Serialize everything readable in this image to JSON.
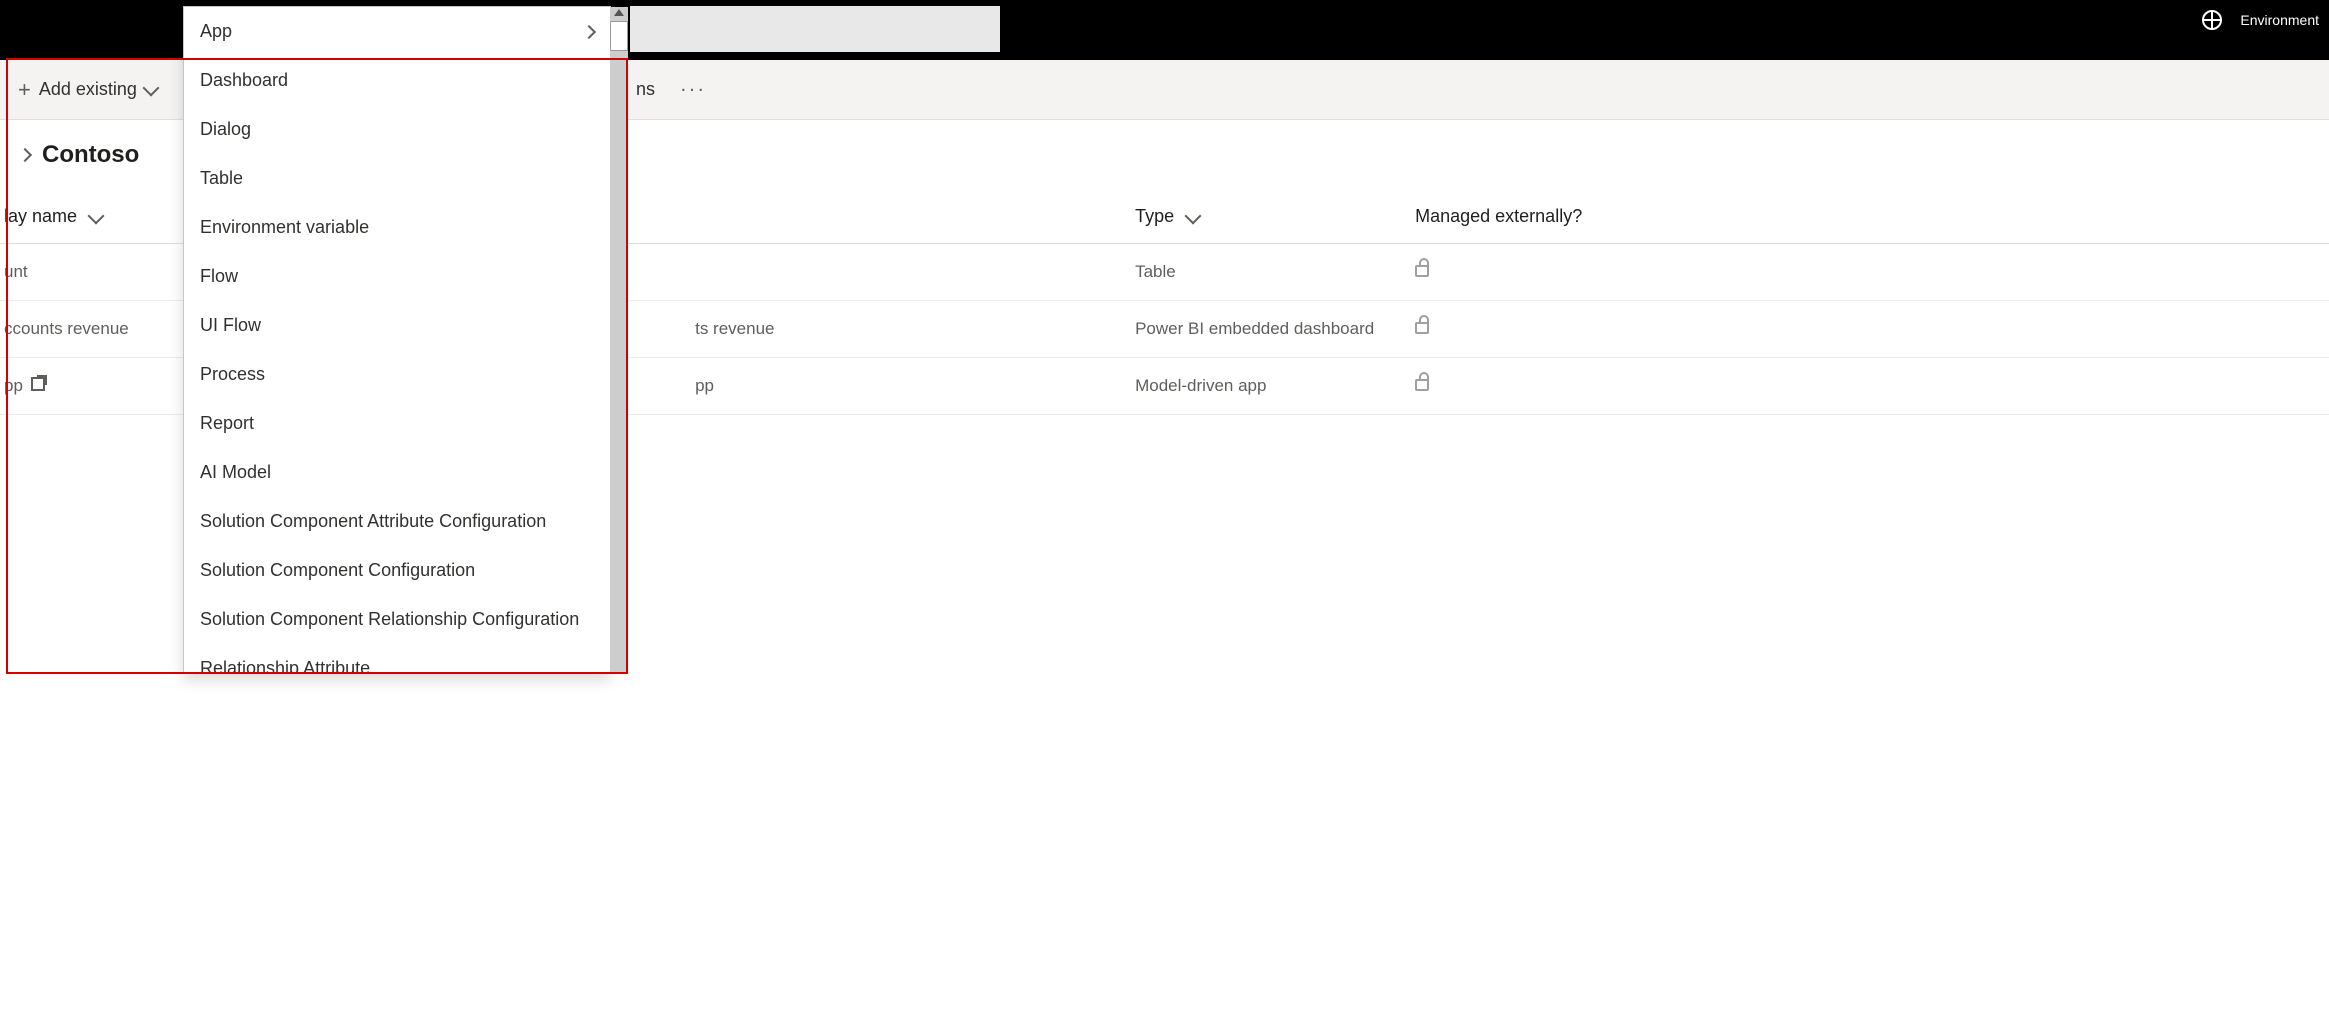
{
  "topbar": {
    "env_label": "Environment"
  },
  "commandbar": {
    "add_existing_label": "Add existing",
    "crumb_fragment": "ns",
    "more_label": "···"
  },
  "page": {
    "title": "Contoso"
  },
  "grid": {
    "headers": {
      "display": "lay name",
      "type": "Type",
      "managed": "Managed externally?"
    },
    "rows": [
      {
        "display": "unt",
        "name2": "",
        "type": "Table",
        "managed_lock": true,
        "openext": false
      },
      {
        "display": "ccounts revenue",
        "name2": "ts revenue",
        "type": "Power BI embedded dashboard",
        "managed_lock": true,
        "openext": false
      },
      {
        "display": "pp",
        "name2": "pp",
        "type": "Model-driven app",
        "managed_lock": true,
        "openext": true
      }
    ]
  },
  "dropdown": {
    "items": [
      {
        "label": "App",
        "has_submenu": true
      },
      {
        "label": "Dashboard",
        "has_submenu": false
      },
      {
        "label": "Dialog",
        "has_submenu": false
      },
      {
        "label": "Table",
        "has_submenu": false
      },
      {
        "label": "Environment variable",
        "has_submenu": false
      },
      {
        "label": "Flow",
        "has_submenu": false
      },
      {
        "label": "UI Flow",
        "has_submenu": false
      },
      {
        "label": "Process",
        "has_submenu": false
      },
      {
        "label": "Report",
        "has_submenu": false
      },
      {
        "label": "AI Model",
        "has_submenu": false
      },
      {
        "label": "Solution Component Attribute Configuration",
        "has_submenu": false
      },
      {
        "label": "Solution Component Configuration",
        "has_submenu": false
      },
      {
        "label": "Solution Component Relationship Configuration",
        "has_submenu": false
      },
      {
        "label": "Relationship Attribute",
        "has_submenu": false
      }
    ]
  }
}
